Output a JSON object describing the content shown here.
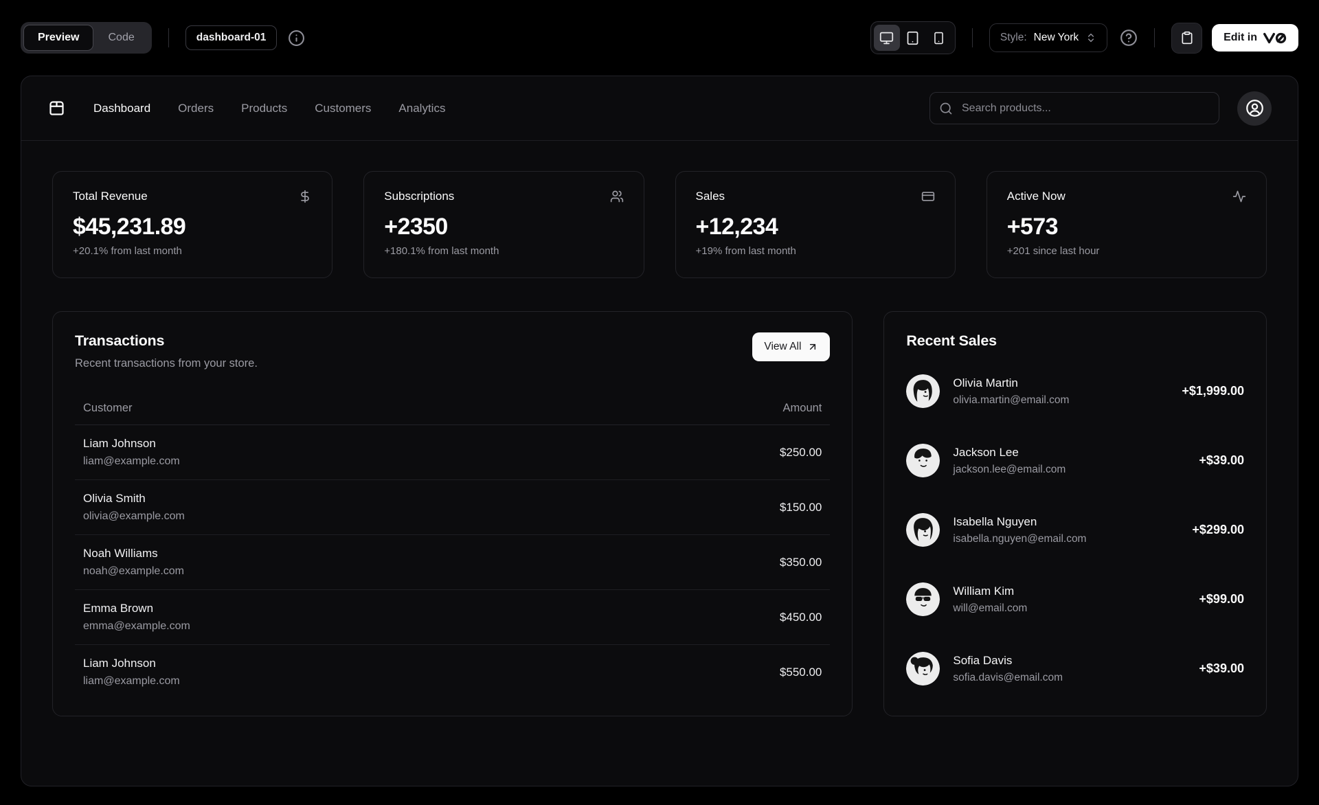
{
  "toolbar": {
    "tabs": [
      {
        "label": "Preview",
        "active": true
      },
      {
        "label": "Code",
        "active": false
      }
    ],
    "block_name": "dashboard-01",
    "style_label": "Style:",
    "style_value": "New York",
    "edit_label": "Edit in",
    "icons": [
      "info-icon",
      "monitor-icon",
      "tablet-icon",
      "smartphone-icon",
      "chevrons-up-down-icon",
      "circle-help-icon",
      "clipboard-icon",
      "v0-logo-icon"
    ]
  },
  "nav": {
    "logo_icon": "package-icon",
    "items": [
      {
        "label": "Dashboard",
        "active": true
      },
      {
        "label": "Orders",
        "active": false
      },
      {
        "label": "Products",
        "active": false
      },
      {
        "label": "Customers",
        "active": false
      },
      {
        "label": "Analytics",
        "active": false
      }
    ],
    "search_placeholder": "Search products...",
    "account_icon": "circle-user-icon"
  },
  "stats": [
    {
      "title": "Total Revenue",
      "icon": "dollar-sign-icon",
      "value": "$45,231.89",
      "change": "+20.1% from last month"
    },
    {
      "title": "Subscriptions",
      "icon": "users-icon",
      "value": "+2350",
      "change": "+180.1% from last month"
    },
    {
      "title": "Sales",
      "icon": "credit-card-icon",
      "value": "+12,234",
      "change": "+19% from last month"
    },
    {
      "title": "Active Now",
      "icon": "activity-icon",
      "value": "+573",
      "change": "+201 since last hour"
    }
  ],
  "transactions": {
    "title": "Transactions",
    "subtitle": "Recent transactions from your store.",
    "view_all_label": "View All",
    "columns": [
      "Customer",
      "Amount"
    ],
    "rows": [
      {
        "name": "Liam Johnson",
        "email": "liam@example.com",
        "amount": "$250.00"
      },
      {
        "name": "Olivia Smith",
        "email": "olivia@example.com",
        "amount": "$150.00"
      },
      {
        "name": "Noah Williams",
        "email": "noah@example.com",
        "amount": "$350.00"
      },
      {
        "name": "Emma Brown",
        "email": "emma@example.com",
        "amount": "$450.00"
      },
      {
        "name": "Liam Johnson",
        "email": "liam@example.com",
        "amount": "$550.00"
      }
    ]
  },
  "recent_sales": {
    "title": "Recent Sales",
    "items": [
      {
        "name": "Olivia Martin",
        "email": "olivia.martin@email.com",
        "amount": "+$1,999.00"
      },
      {
        "name": "Jackson Lee",
        "email": "jackson.lee@email.com",
        "amount": "+$39.00"
      },
      {
        "name": "Isabella Nguyen",
        "email": "isabella.nguyen@email.com",
        "amount": "+$299.00"
      },
      {
        "name": "William Kim",
        "email": "will@email.com",
        "amount": "+$99.00"
      },
      {
        "name": "Sofia Davis",
        "email": "sofia.davis@email.com",
        "amount": "+$39.00"
      }
    ]
  },
  "colors": {
    "page_bg": "#000000",
    "panel_bg": "#0b0b0d",
    "card_border": "#232328",
    "muted_text": "#9b9ba3",
    "accent_button_bg": "#fafafa"
  }
}
